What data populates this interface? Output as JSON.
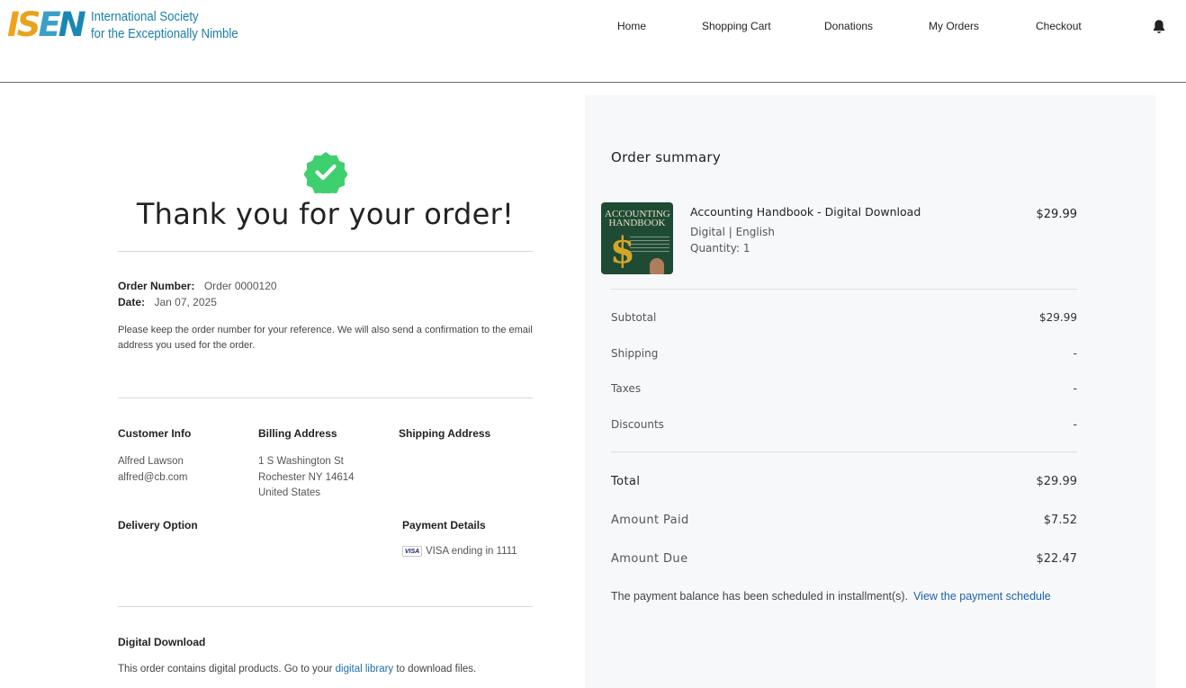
{
  "header": {
    "logo_mark": "ISEN",
    "logo_line1": "International Society",
    "logo_line2": "for the Exceptionally Nimble",
    "nav": [
      "Home",
      "Shopping Cart",
      "Donations",
      "My Orders",
      "Checkout"
    ],
    "bell_icon": "bell-icon"
  },
  "confirmation": {
    "title": "Thank you for your order!",
    "check_icon": "check-badge-icon",
    "order_number_label": "Order Number:",
    "order_number": "Order 0000120",
    "date_label": "Date:",
    "date": "Jan 07, 2025",
    "note": "Please keep the order number for your reference. We will also send a confirmation to the email address you used for the order."
  },
  "customer": {
    "heading": "Customer Info",
    "name": "Alfred Lawson",
    "email": "alfred@cb.com"
  },
  "billing": {
    "heading": "Billing Address",
    "line1": "1 S Washington St",
    "line2": "Rochester NY 14614",
    "line3": "United States"
  },
  "shipping": {
    "heading": "Shipping Address"
  },
  "delivery": {
    "heading": "Delivery Option"
  },
  "payment": {
    "heading": "Payment Details",
    "card_brand": "VISA",
    "card_text": "VISA ending in 1111"
  },
  "digital": {
    "heading": "Digital Download",
    "text_before": "This order contains digital products. Go to your ",
    "link": "digital library",
    "text_after": " to download files."
  },
  "summary": {
    "title": "Order summary",
    "item": {
      "name": "Accounting Handbook - Digital Download",
      "format": "Digital | English",
      "quantity": "Quantity: 1",
      "price": "$29.99",
      "thumb_title": "ACCOUNTING HANDBOOK",
      "thumb_symbol": "$"
    },
    "subtotal_label": "Subtotal",
    "subtotal": "$29.99",
    "shipping_label": "Shipping",
    "shipping": "-",
    "taxes_label": "Taxes",
    "taxes": "-",
    "discounts_label": "Discounts",
    "discounts": "-",
    "total_label": "Total",
    "total": "$29.99",
    "paid_label": "Amount Paid",
    "paid": "$7.52",
    "due_label": "Amount Due",
    "due": "$22.47",
    "schedule_text": "The payment balance has been scheduled in installment(s).",
    "schedule_link": "View the payment schedule"
  },
  "colors": {
    "accent_link": "#1b63b0",
    "check_green": "#3ecf6e",
    "panel_bg": "#f7f8f9"
  }
}
